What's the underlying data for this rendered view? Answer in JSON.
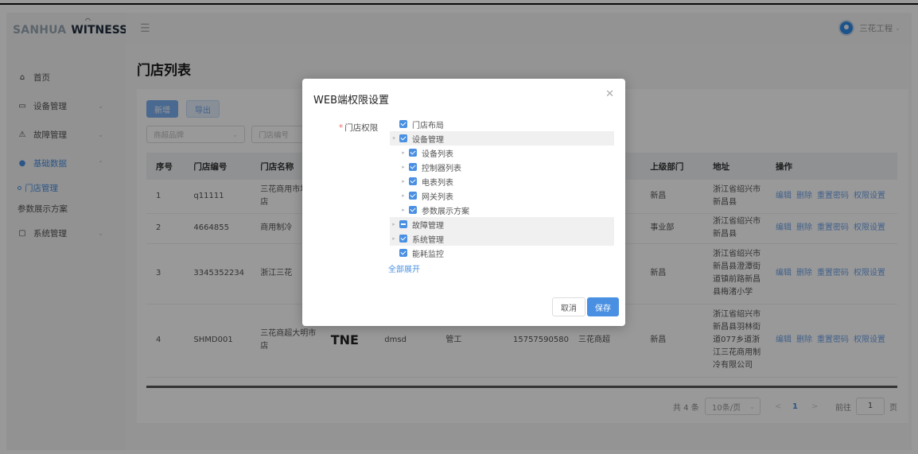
{
  "app": {
    "logo_text": "SANHUA",
    "logo_text2": "WITNESS",
    "user_name": "三花工程"
  },
  "sidebar": {
    "items": [
      {
        "label": "首页",
        "icon": "home-icon"
      },
      {
        "label": "设备管理",
        "icon": "monitor-icon"
      },
      {
        "label": "故障管理",
        "icon": "warning-icon"
      },
      {
        "label": "基础数据",
        "icon": "database-icon"
      },
      {
        "label": "系统管理",
        "icon": "chat-icon"
      }
    ],
    "sub_items": [
      {
        "label": "门店管理"
      },
      {
        "label": "参数展示方案"
      }
    ]
  },
  "page": {
    "title": "门店列表"
  },
  "toolbar": {
    "add_label": "新增",
    "export_label": "导出"
  },
  "filters": {
    "brand_placeholder": "商超品牌",
    "store_code_placeholder": "门店编号"
  },
  "table": {
    "headers": [
      "序号",
      "门店编号",
      "门店名称",
      "上级部门",
      "地址",
      "操作"
    ],
    "rows": [
      {
        "index": "1",
        "code": "q11111",
        "name": "三花商用市场门店",
        "dept": "新昌",
        "address": "浙江省绍兴市新昌县"
      },
      {
        "index": "2",
        "code": "4664855",
        "name": "商用制冷",
        "dept": "事业部",
        "address": "浙江省绍兴市新昌县"
      },
      {
        "index": "3",
        "code": "3345352234",
        "name": "浙江三花",
        "dept": "新昌",
        "address": "浙江省绍兴市新昌县澄潭街道镇前路新昌县梅渚小学"
      },
      {
        "index": "4",
        "code": "SHMD001",
        "name": "三花商超大明市店",
        "logo_text": "TNE",
        "contact": "dmsd",
        "role": "管工",
        "phone": "15757590580",
        "brand": "三花商超",
        "dept": "新昌",
        "address": "浙江省绍兴市新昌县羽林街道077乡道浙江三花商用制冷有限公司"
      }
    ],
    "ops": [
      "编辑",
      "删除",
      "重置密码",
      "权限设置"
    ]
  },
  "pagination": {
    "total": "共 4 条",
    "page_size": "10条/页",
    "prev": "<",
    "current": "1",
    "next": ">",
    "goto": "前往",
    "goto_value": "1",
    "page_unit": "页"
  },
  "modal": {
    "title": "WEB端权限设置",
    "field_label": "门店权限",
    "tree": [
      {
        "label": "门店布局",
        "level": 0,
        "arrow": "",
        "state": "full"
      },
      {
        "label": "设备管理",
        "level": 0,
        "arrow": "▾",
        "state": "full"
      },
      {
        "label": "设备列表",
        "level": 1,
        "arrow": "▸",
        "state": "full"
      },
      {
        "label": "控制器列表",
        "level": 1,
        "arrow": "▸",
        "state": "full"
      },
      {
        "label": "电表列表",
        "level": 1,
        "arrow": "▸",
        "state": "full"
      },
      {
        "label": "网关列表",
        "level": 1,
        "arrow": "▸",
        "state": "full"
      },
      {
        "label": "参数展示方案",
        "level": 1,
        "arrow": "▸",
        "state": "full"
      },
      {
        "label": "故障管理",
        "level": 0,
        "arrow": "▸",
        "state": "partial"
      },
      {
        "label": "系统管理",
        "level": 0,
        "arrow": "▸",
        "state": "full"
      },
      {
        "label": "能耗监控",
        "level": 0,
        "arrow": "",
        "state": "full"
      }
    ],
    "expand_all": "全部展开",
    "cancel": "取消",
    "save": "保存"
  }
}
